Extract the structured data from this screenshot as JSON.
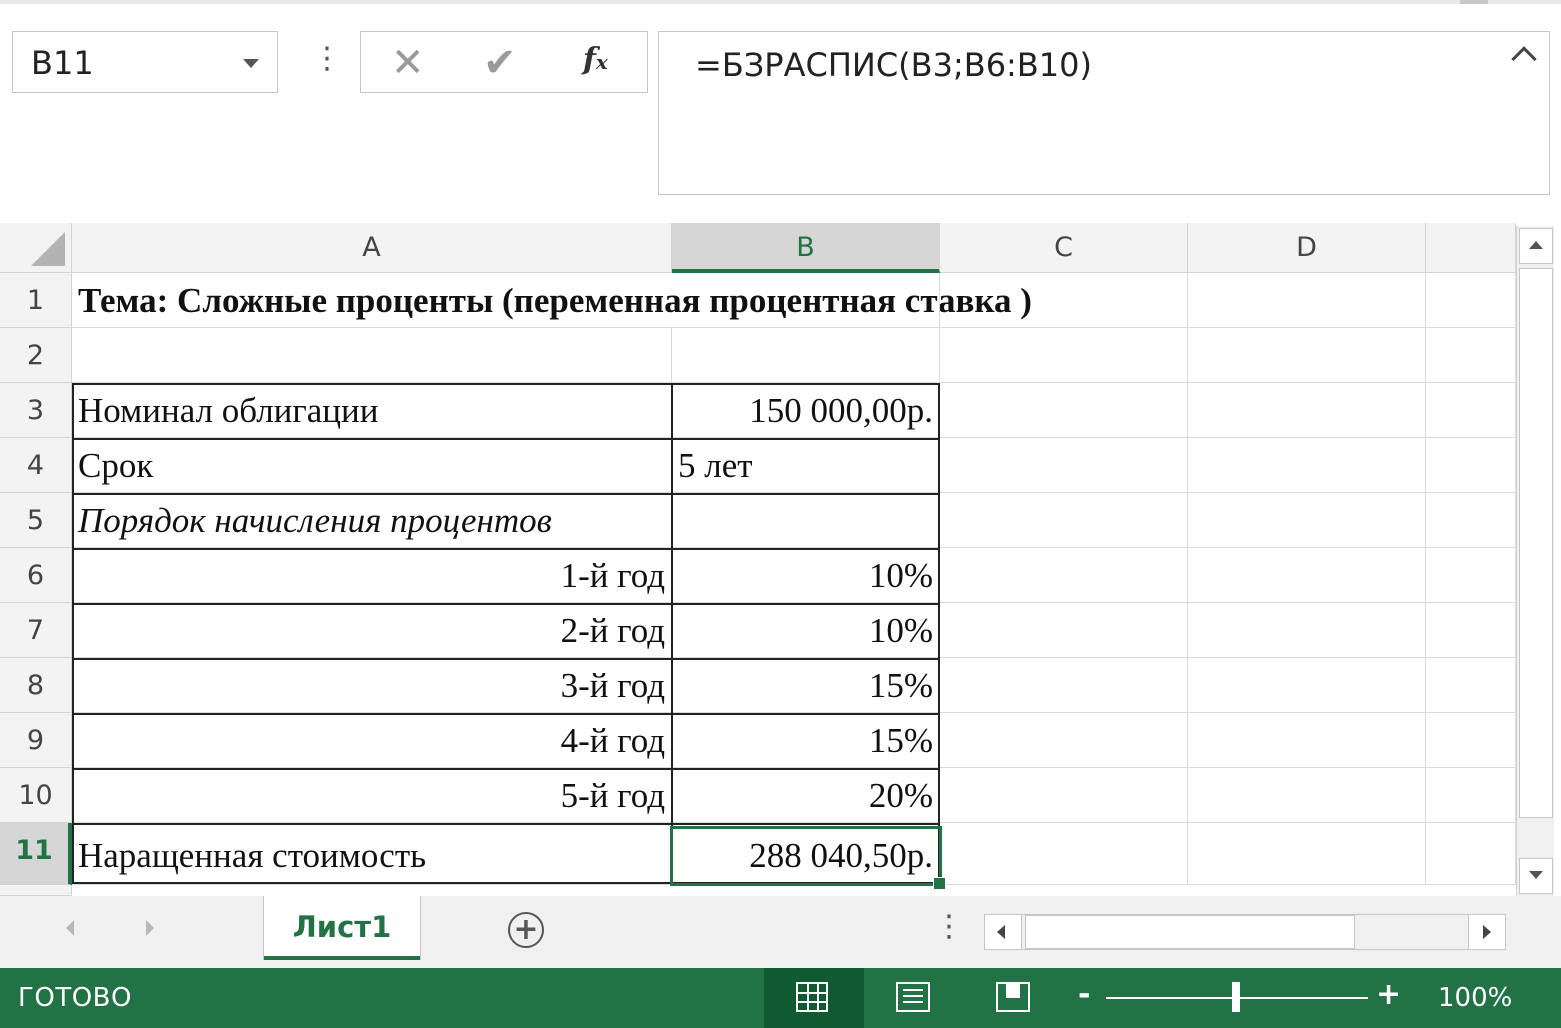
{
  "formula_bar": {
    "name_box": "B11",
    "formula": "=БЗРАСПИС(B3;B6:B10)",
    "more_icon": "vertical-ellipsis",
    "cancel_icon": "✕",
    "enter_icon": "✔",
    "fx_label": "fx"
  },
  "columns": [
    "A",
    "B",
    "C",
    "D"
  ],
  "selected_column": "B",
  "rows": [
    "1",
    "2",
    "3",
    "4",
    "5",
    "6",
    "7",
    "8",
    "9",
    "10",
    "11"
  ],
  "selected_row": "11",
  "cells": {
    "A1": "Тема: Сложные проценты (переменная процентная ставка )",
    "A3": "Номинал облигации",
    "B3": "150 000,00р.",
    "A4": "Срок",
    "B4": "5 лет",
    "A5": "Порядок начисления процентов",
    "A6": "1-й год",
    "B6": "10%",
    "A7": "2-й год",
    "B7": "10%",
    "A8": "3-й год",
    "B8": "15%",
    "A9": "4-й год",
    "B9": "15%",
    "A10": "5-й год",
    "B10": "20%",
    "A11": "Наращенная стоимость",
    "B11": "288 040,50р."
  },
  "sheet_tabs": {
    "active": "Лист1",
    "add_icon": "+"
  },
  "status_bar": {
    "status": "ГОТОВО",
    "zoom_minus": "-",
    "zoom_plus": "+",
    "zoom": "100%",
    "zoom_level_percent": 100
  },
  "colors": {
    "accent": "#217346",
    "status_bar_bg": "#217346",
    "header_bg": "#f3f3f3",
    "selected_header_bg": "#d6d6d6"
  }
}
